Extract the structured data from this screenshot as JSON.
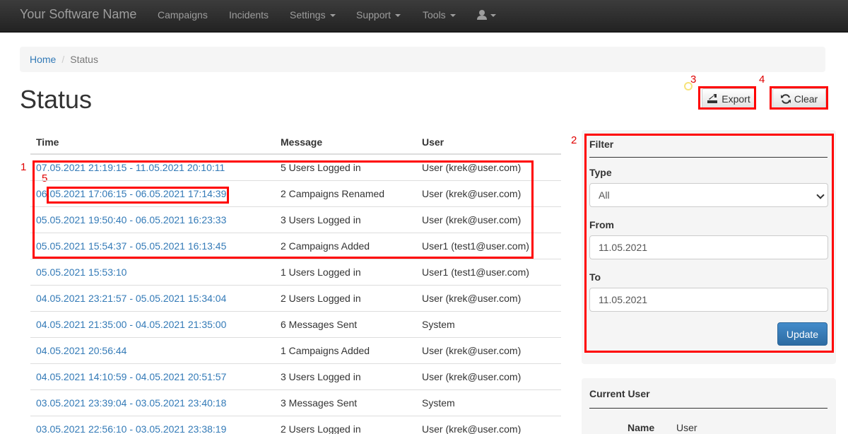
{
  "navbar": {
    "brand": "Your Software Name",
    "items": [
      {
        "label": "Campaigns"
      },
      {
        "label": "Incidents"
      },
      {
        "label": "Settings"
      },
      {
        "label": "Support"
      },
      {
        "label": "Tools"
      }
    ]
  },
  "breadcrumb": {
    "home": "Home",
    "separator": "/",
    "current": "Status"
  },
  "page_title": "Status",
  "toolbar": {
    "export_label": "Export",
    "clear_label": "Clear"
  },
  "annotations": [
    "1",
    "2",
    "3",
    "4",
    "5"
  ],
  "table": {
    "headers": {
      "time": "Time",
      "message": "Message",
      "user": "User"
    },
    "rows": [
      {
        "time": "07.05.2021 21:19:15 - 11.05.2021 20:10:11",
        "message": "5 Users Logged in",
        "user": "User (krek@user.com)"
      },
      {
        "time": "06.05.2021 17:06:15 - 06.05.2021 17:14:39",
        "message": "2 Campaigns Renamed",
        "user": "User (krek@user.com)"
      },
      {
        "time": "05.05.2021 19:50:40 - 06.05.2021 16:23:33",
        "message": "3 Users Logged in",
        "user": "User (krek@user.com)"
      },
      {
        "time": "05.05.2021 15:54:37 - 05.05.2021 16:13:45",
        "message": "2 Campaigns Added",
        "user": "User1 (test1@user.com)"
      },
      {
        "time": "05.05.2021 15:53:10",
        "message": "1 Users Logged in",
        "user": "User1 (test1@user.com)"
      },
      {
        "time": "04.05.2021 23:21:57 - 05.05.2021 15:34:04",
        "message": "2 Users Logged in",
        "user": "User (krek@user.com)"
      },
      {
        "time": "04.05.2021 21:35:00 - 04.05.2021 21:35:00",
        "message": "6 Messages Sent",
        "user": "System"
      },
      {
        "time": "04.05.2021 20:56:44",
        "message": "1 Campaigns Added",
        "user": "User (krek@user.com)"
      },
      {
        "time": "04.05.2021 14:10:59 - 04.05.2021 20:51:57",
        "message": "3 Users Logged in",
        "user": "User (krek@user.com)"
      },
      {
        "time": "03.05.2021 23:39:04 - 03.05.2021 23:40:18",
        "message": "3 Messages Sent",
        "user": "System"
      },
      {
        "time": "03.05.2021 22:56:10 - 03.05.2021 23:38:19",
        "message": "2 Users Logged in",
        "user": "User (krek@user.com)"
      }
    ]
  },
  "filter": {
    "heading": "Filter",
    "type_label": "Type",
    "type_value": "All",
    "from_label": "From",
    "from_value": "11.05.2021",
    "to_label": "To",
    "to_value": "11.05.2021",
    "update_label": "Update"
  },
  "current_user": {
    "heading": "Current User",
    "name_label": "Name",
    "name_value": "User"
  }
}
